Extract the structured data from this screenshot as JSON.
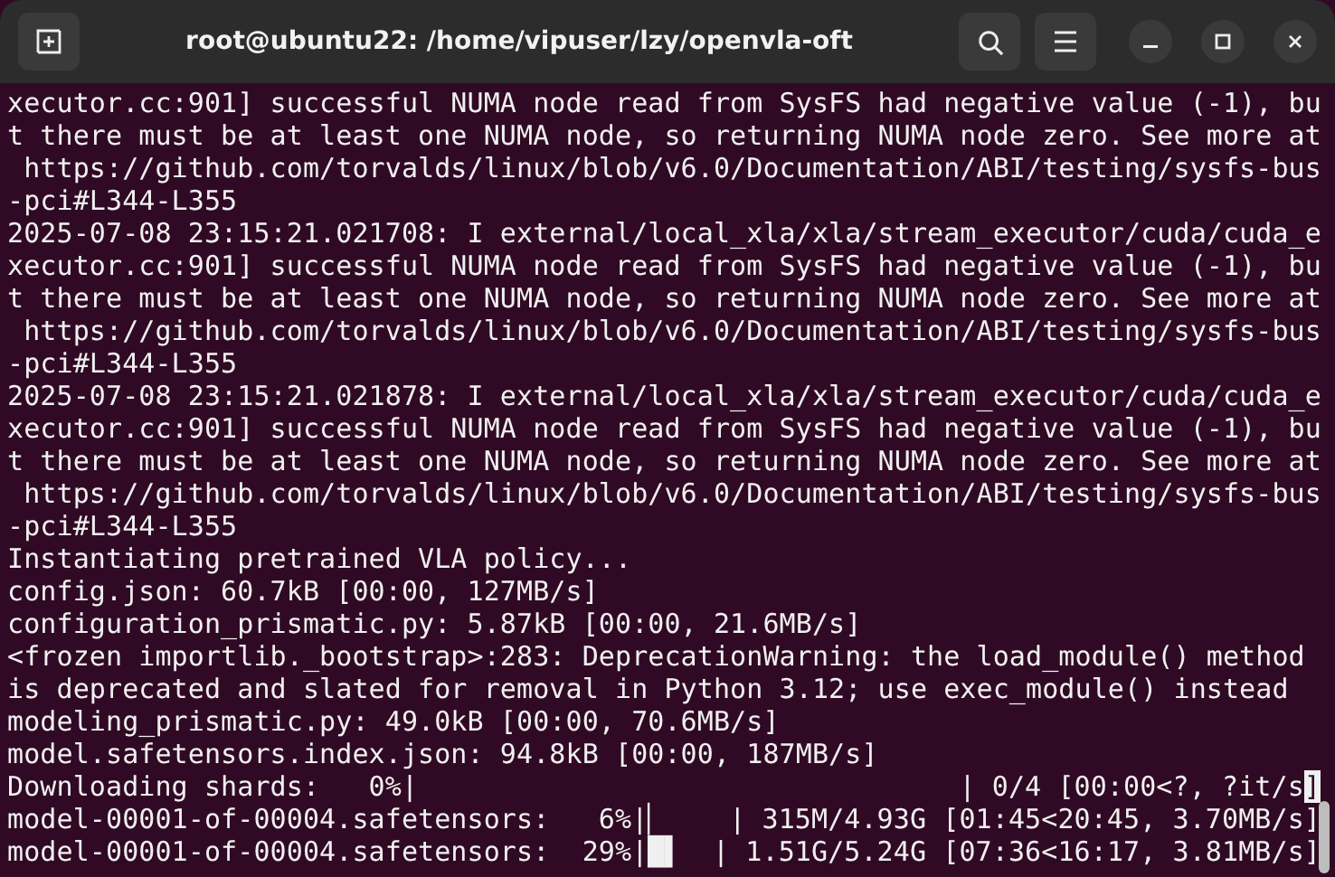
{
  "window": {
    "title": "root@ubuntu22: /home/vipuser/lzy/openvla-oft"
  },
  "terminal": {
    "lines": [
      {
        "kind": "text",
        "text": "xecutor.cc:901] successful NUMA node read from SysFS had negative value (-1), bu"
      },
      {
        "kind": "text",
        "text": "t there must be at least one NUMA node, so returning NUMA node zero. See more at"
      },
      {
        "kind": "text",
        "text": " https://github.com/torvalds/linux/blob/v6.0/Documentation/ABI/testing/sysfs-bus"
      },
      {
        "kind": "text",
        "text": "-pci#L344-L355"
      },
      {
        "kind": "text",
        "text": "2025-07-08 23:15:21.021708: I external/local_xla/xla/stream_executor/cuda/cuda_e"
      },
      {
        "kind": "text",
        "text": "xecutor.cc:901] successful NUMA node read from SysFS had negative value (-1), bu"
      },
      {
        "kind": "text",
        "text": "t there must be at least one NUMA node, so returning NUMA node zero. See more at"
      },
      {
        "kind": "text",
        "text": " https://github.com/torvalds/linux/blob/v6.0/Documentation/ABI/testing/sysfs-bus"
      },
      {
        "kind": "text",
        "text": "-pci#L344-L355"
      },
      {
        "kind": "text",
        "text": "2025-07-08 23:15:21.021878: I external/local_xla/xla/stream_executor/cuda/cuda_e"
      },
      {
        "kind": "text",
        "text": "xecutor.cc:901] successful NUMA node read from SysFS had negative value (-1), bu"
      },
      {
        "kind": "text",
        "text": "t there must be at least one NUMA node, so returning NUMA node zero. See more at"
      },
      {
        "kind": "text",
        "text": " https://github.com/torvalds/linux/blob/v6.0/Documentation/ABI/testing/sysfs-bus"
      },
      {
        "kind": "text",
        "text": "-pci#L344-L355"
      },
      {
        "kind": "text",
        "text": "Instantiating pretrained VLA policy..."
      },
      {
        "kind": "text",
        "text": "config.json: 60.7kB [00:00, 127MB/s]"
      },
      {
        "kind": "text",
        "text": "configuration_prismatic.py: 5.87kB [00:00, 21.6MB/s]"
      },
      {
        "kind": "text",
        "text": "<frozen importlib._bootstrap>:283: DeprecationWarning: the load_module() method"
      },
      {
        "kind": "text",
        "text": "is deprecated and slated for removal in Python 3.12; use exec_module() instead"
      },
      {
        "kind": "text",
        "text": "modeling_prismatic.py: 49.0kB [00:00, 70.6MB/s]"
      },
      {
        "kind": "text",
        "text": "model.safetensors.index.json: 94.8kB [00:00, 187MB/s]"
      },
      {
        "kind": "progress",
        "label": "Downloading shards:   0%|",
        "stats": "| 0/4 [00:00<?, ?it/s",
        "cursor": "]"
      },
      {
        "kind": "progress",
        "label": "model-00001-of-00004.safetensors:   6%|",
        "bar": "▏",
        "stats": "| 315M/4.93G [01:45<20:45, 3.70MB/s]"
      },
      {
        "kind": "progress",
        "label": "model-00001-of-00004.safetensors:  29%|",
        "bar": "█▌",
        "stats": "| 1.51G/5.24G [07:36<16:17, 3.81MB/s]"
      }
    ]
  }
}
